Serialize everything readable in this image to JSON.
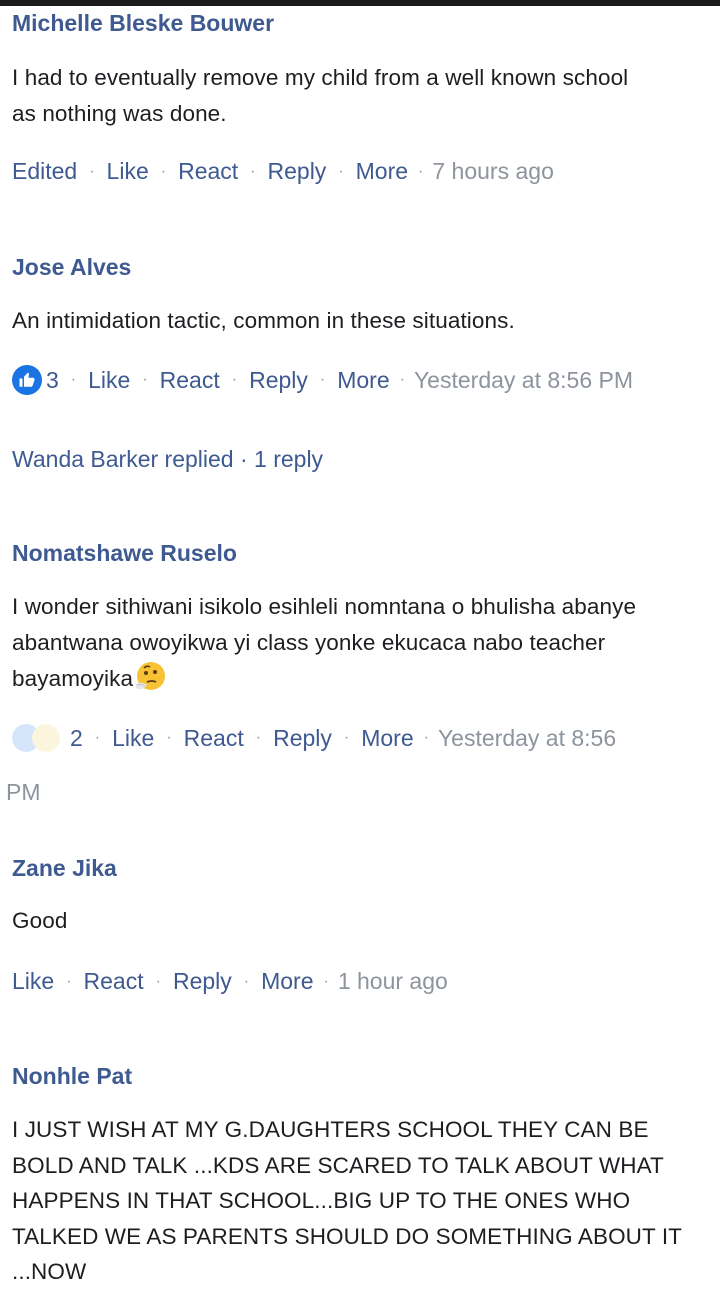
{
  "comments": [
    {
      "author": "Michelle Bleske Bouwer",
      "text_lines": [
        "I had to eventually remove my child from a well known school",
        "as nothing was done."
      ],
      "edited": "Edited",
      "like": "Like",
      "react": "React",
      "reply": "Reply",
      "more": "More",
      "time": "7 hours ago"
    },
    {
      "author": "Jose Alves",
      "text_lines": [
        "An intimidation tactic, common in these situations."
      ],
      "reaction_count": "3",
      "like": "Like",
      "react": "React",
      "reply": "Reply",
      "more": "More",
      "time": "Yesterday at 8:56 PM",
      "replied": "Wanda Barker replied · 1 reply"
    },
    {
      "author": "Nomatshawe Ruselo",
      "text_lines": [
        "I wonder sithiwani isikolo esihleli nomntana o bhulisha abanye",
        "abantwana owoyikwa yi class yonke ekucaca nabo teacher",
        "bayamoyika"
      ],
      "reaction_count": "2",
      "like": "Like",
      "react": "React",
      "reply": "Reply",
      "more": "More",
      "time": "Yesterday at 8:56",
      "time_wrap": "PM"
    },
    {
      "author": "Zane Jika",
      "text_lines": [
        "Good"
      ],
      "like": "Like",
      "react": "React",
      "reply": "Reply",
      "more": "More",
      "time": "1 hour ago"
    },
    {
      "author": "Nonhle Pat",
      "text_lines": [
        "I JUST WISH AT MY G.DAUGHTERS SCHOOL THEY CAN BE",
        "BOLD AND TALK ...KDS ARE SCARED TO TALK ABOUT WHAT",
        "HAPPENS IN THAT SCHOOL...BIG UP TO THE ONES WHO",
        "TALKED WE AS PARENTS SHOULD DO SOMETHING ABOUT IT",
        "...NOW"
      ]
    }
  ],
  "colors": {
    "name": "#3e5a91",
    "text": "#1c1e21",
    "meta": "#8d949e",
    "like": "#1b74e4"
  },
  "icons": {
    "like_badge": "thumbs-up-icon",
    "emoji": "thinking-face-emoji"
  }
}
